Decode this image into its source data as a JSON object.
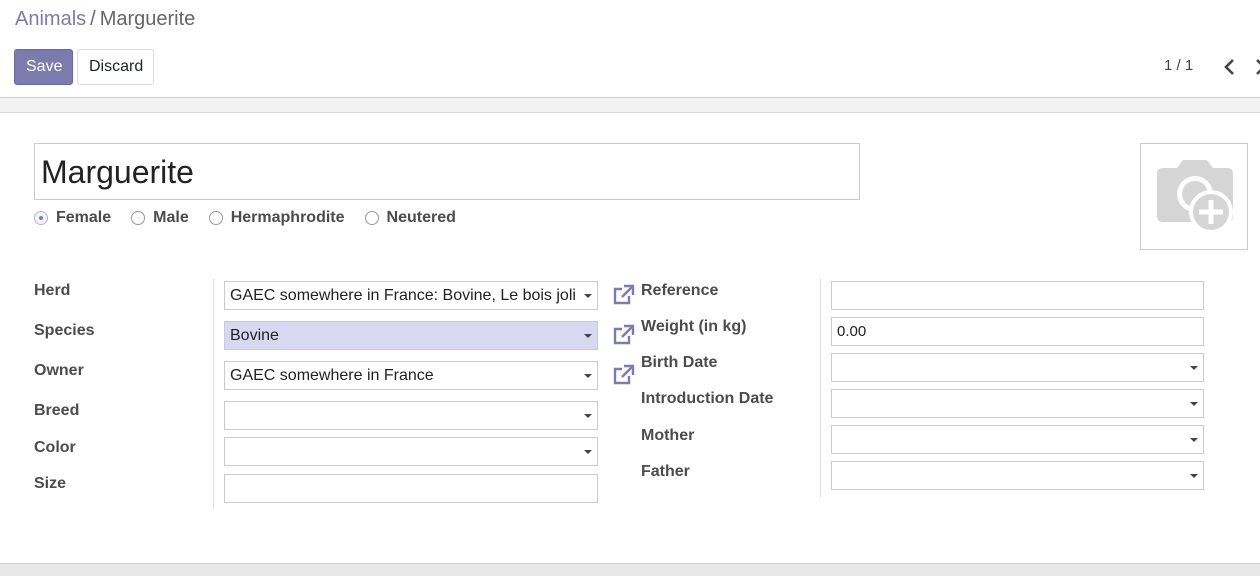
{
  "breadcrumb": {
    "parent": "Animals",
    "separator": "/",
    "current": "Marguerite"
  },
  "toolbar": {
    "save_label": "Save",
    "discard_label": "Discard"
  },
  "pager": {
    "value": "1 / 1"
  },
  "record": {
    "name": "Marguerite",
    "gender_options": [
      {
        "label": "Female",
        "checked": true
      },
      {
        "label": "Male",
        "checked": false
      },
      {
        "label": "Hermaphrodite",
        "checked": false
      },
      {
        "label": "Neutered",
        "checked": false
      }
    ]
  },
  "left_fields": {
    "herd": {
      "label": "Herd",
      "value": "GAEC somewhere in France: Bovine,  Le bois joli"
    },
    "species": {
      "label": "Species",
      "value": "Bovine"
    },
    "owner": {
      "label": "Owner",
      "value": "GAEC somewhere in France"
    },
    "breed": {
      "label": "Breed",
      "value": ""
    },
    "color": {
      "label": "Color",
      "value": ""
    },
    "size": {
      "label": "Size",
      "value": ""
    }
  },
  "right_fields": {
    "reference": {
      "label": "Reference",
      "value": ""
    },
    "weight": {
      "label": "Weight (in kg)",
      "value": "0.00"
    },
    "birth_date": {
      "label": "Birth Date",
      "value": ""
    },
    "introduction_date": {
      "label": "Introduction Date",
      "value": ""
    },
    "mother": {
      "label": "Mother",
      "value": ""
    },
    "father": {
      "label": "Father",
      "value": ""
    }
  },
  "icons": {
    "external_link": "external-link-icon",
    "camera_add": "camera-add-icon",
    "chevron_left": "chevron-left-icon",
    "chevron_right": "chevron-right-icon"
  },
  "colors": {
    "accent": "#7c7bad",
    "highlight": "#d9d8f1"
  }
}
